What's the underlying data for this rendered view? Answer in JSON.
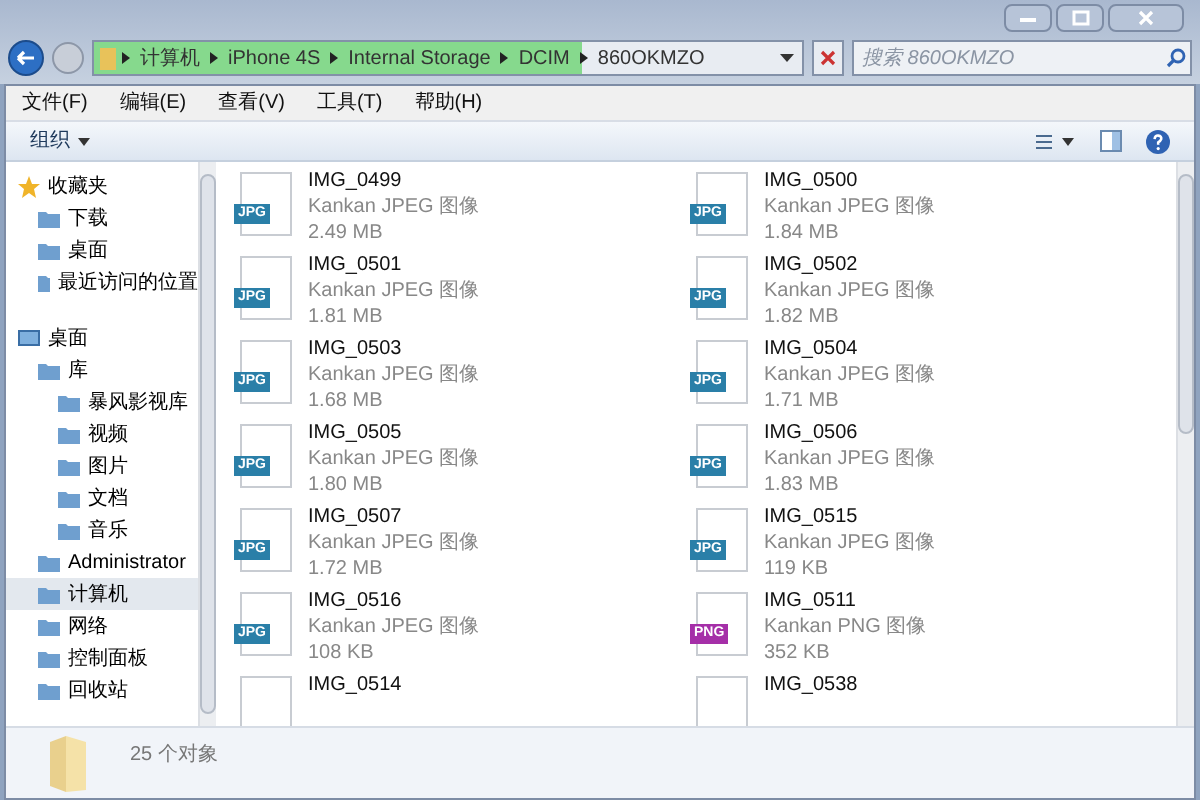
{
  "address_bar": {
    "crumbs": [
      "计算机",
      "iPhone 4S",
      "Internal Storage",
      "DCIM",
      "860OKMZO"
    ],
    "level": 0.69
  },
  "search": {
    "placeholder": "搜索 860OKMZO"
  },
  "menu": [
    "文件(F)",
    "编辑(E)",
    "查看(V)",
    "工具(T)",
    "帮助(H)"
  ],
  "toolbar": {
    "organize": "组织"
  },
  "sidebar": {
    "groups": [
      {
        "label": "收藏夹",
        "selected": false,
        "children": [
          {
            "label": "下载",
            "selected": false
          },
          {
            "label": "桌面",
            "selected": false
          },
          {
            "label": "最近访问的位置",
            "selected": false
          }
        ]
      },
      {
        "label": "桌面",
        "selected": false,
        "children": [
          {
            "label": "库",
            "selected": false,
            "children": [
              {
                "label": "暴风影视库",
                "selected": false
              },
              {
                "label": "视频",
                "selected": false
              },
              {
                "label": "图片",
                "selected": false
              },
              {
                "label": "文档",
                "selected": false
              },
              {
                "label": "音乐",
                "selected": false
              }
            ]
          },
          {
            "label": "Administrator",
            "selected": false
          },
          {
            "label": "计算机",
            "selected": true
          },
          {
            "label": "网络",
            "selected": false
          },
          {
            "label": "控制面板",
            "selected": false
          },
          {
            "label": "回收站",
            "selected": false
          }
        ]
      }
    ]
  },
  "files": [
    {
      "name": "IMG_0499",
      "type": "Kankan JPEG 图像",
      "size": "2.49 MB",
      "badge": "JPG",
      "color": "#2a7fa8"
    },
    {
      "name": "IMG_0500",
      "type": "Kankan JPEG 图像",
      "size": "1.84 MB",
      "badge": "JPG",
      "color": "#2a7fa8"
    },
    {
      "name": "IMG_0501",
      "type": "Kankan JPEG 图像",
      "size": "1.81 MB",
      "badge": "JPG",
      "color": "#2a7fa8"
    },
    {
      "name": "IMG_0502",
      "type": "Kankan JPEG 图像",
      "size": "1.82 MB",
      "badge": "JPG",
      "color": "#2a7fa8"
    },
    {
      "name": "IMG_0503",
      "type": "Kankan JPEG 图像",
      "size": "1.68 MB",
      "badge": "JPG",
      "color": "#2a7fa8"
    },
    {
      "name": "IMG_0504",
      "type": "Kankan JPEG 图像",
      "size": "1.71 MB",
      "badge": "JPG",
      "color": "#2a7fa8"
    },
    {
      "name": "IMG_0505",
      "type": "Kankan JPEG 图像",
      "size": "1.80 MB",
      "badge": "JPG",
      "color": "#2a7fa8"
    },
    {
      "name": "IMG_0506",
      "type": "Kankan JPEG 图像",
      "size": "1.83 MB",
      "badge": "JPG",
      "color": "#2a7fa8"
    },
    {
      "name": "IMG_0507",
      "type": "Kankan JPEG 图像",
      "size": "1.72 MB",
      "badge": "JPG",
      "color": "#2a7fa8"
    },
    {
      "name": "IMG_0515",
      "type": "Kankan JPEG 图像",
      "size": "119 KB",
      "badge": "JPG",
      "color": "#2a7fa8"
    },
    {
      "name": "IMG_0516",
      "type": "Kankan JPEG 图像",
      "size": "108 KB",
      "badge": "JPG",
      "color": "#2a7fa8"
    },
    {
      "name": "IMG_0511",
      "type": "Kankan PNG 图像",
      "size": "352 KB",
      "badge": "PNG",
      "color": "#a52fa8"
    },
    {
      "name": "IMG_0514"
    },
    {
      "name": "IMG_0538"
    }
  ],
  "status_bar": {
    "count": "25 个对象"
  }
}
